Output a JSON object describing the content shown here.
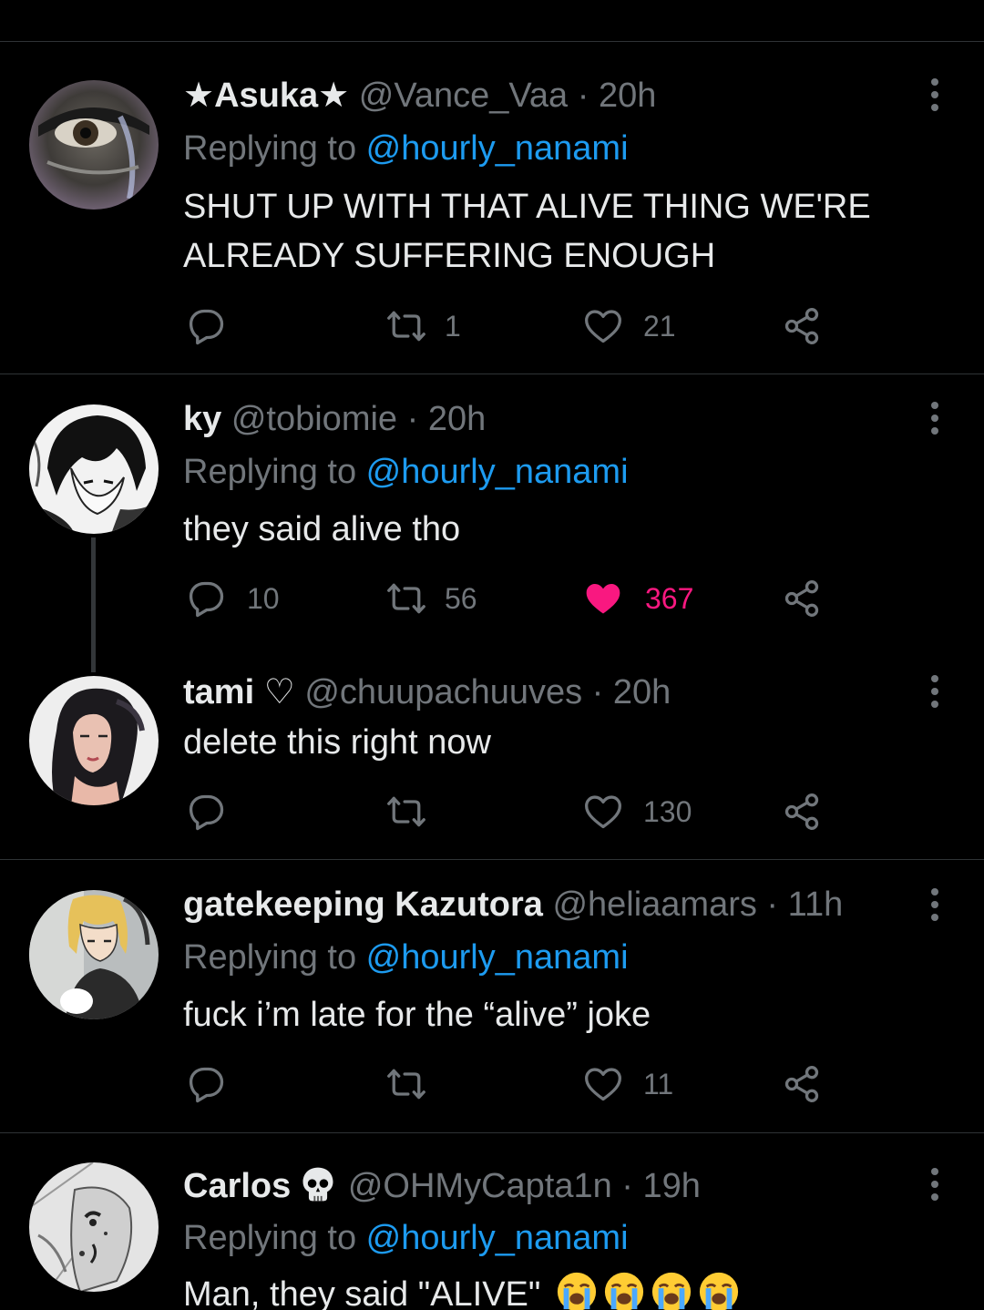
{
  "tweets": [
    {
      "name": "★Asuka★",
      "handle": "@Vance_Vaa",
      "time": "20h",
      "replying_prefix": "Replying to ",
      "replying_to": "@hourly_nanami",
      "text": "SHUT UP WITH THAT ALIVE THING WE'RE ALREADY SUFFERING ENOUGH",
      "reply_count": "",
      "retweet_count": "1",
      "like_count": "21",
      "liked": false
    },
    {
      "name": "ky",
      "handle": "@tobiomie",
      "time": "20h",
      "replying_prefix": "Replying to ",
      "replying_to": "@hourly_nanami",
      "text": "they said alive tho",
      "reply_count": "10",
      "retweet_count": "56",
      "like_count": "367",
      "liked": true
    },
    {
      "name": "tami ♡",
      "handle": "@chuupachuuves",
      "time": "20h",
      "text": "delete this right now",
      "reply_count": "",
      "retweet_count": "",
      "like_count": "130",
      "liked": false
    },
    {
      "name": "gatekeeping Kazutora",
      "handle": "@heliaamars",
      "time": "11h",
      "replying_prefix": "Replying to ",
      "replying_to": "@hourly_nanami",
      "text": "fuck i’m late for the “alive” joke",
      "reply_count": "",
      "retweet_count": "",
      "like_count": "11",
      "liked": false
    },
    {
      "name": "Carlos",
      "name_emoji": "skull-emoji",
      "handle": "@OHMyCapta1n",
      "time": "19h",
      "replying_prefix": "Replying to ",
      "replying_to": "@hourly_nanami",
      "text": "Man, they said \"ALIVE\"",
      "text_emoji": [
        "loudly-crying-face-emoji",
        "loudly-crying-face-emoji",
        "loudly-crying-face-emoji",
        "loudly-crying-face-emoji"
      ]
    }
  ],
  "meta_separator": " · ",
  "icons": {
    "reply": "reply-bubble-icon",
    "retweet": "retweet-icon",
    "like": "heart-icon",
    "share": "share-icon",
    "more": "more-vertical-icon"
  },
  "colors": {
    "background": "#000000",
    "text": "#e7e9ea",
    "muted": "#71767b",
    "link": "#1d9bf0",
    "like_active": "#f91880",
    "divider": "#2f3336"
  }
}
